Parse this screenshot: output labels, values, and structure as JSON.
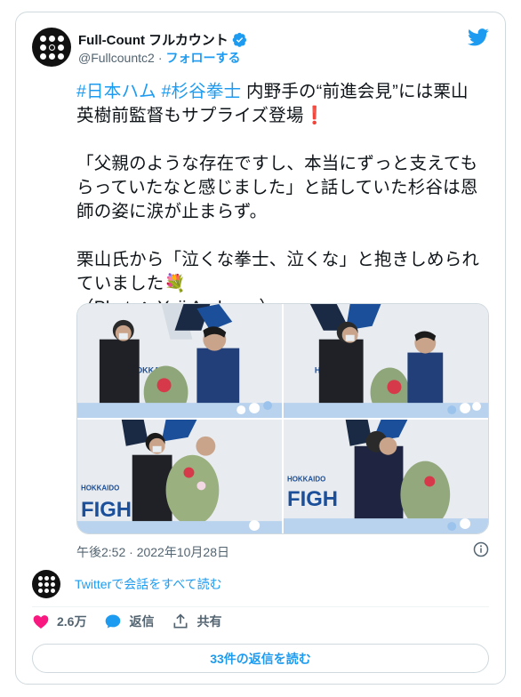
{
  "account": {
    "name": "Full-Count フルカウント",
    "handle": "@Fullcountc2",
    "separator": "·",
    "follow_label": "フォローする"
  },
  "tweet": {
    "line1_hashtag1": "#日本ハム",
    "line1_hashtag2": "#杉谷拳士",
    "line1_rest": " 内野手の“前進会見”には栗山",
    "line2": "英樹前監督もサプライズ登場",
    "line2_emoji": "❗",
    "para2_l1": "「父親のような存在ですし、本当にずっと支えても",
    "para2_l2": "らっていたなと感じました」と話していた杉谷は恩",
    "para2_l3": "師の姿に涙が止まらず。",
    "para3_l1": "栗山氏から「泣くな拳士、泣くな」と抱きしめられ",
    "para3_l2": "ていました",
    "para3_emoji": "💐",
    "para3_l3": "（Photo：Yuji Arakawa）"
  },
  "timestamp": "午後2:52 · 2022年10月28日",
  "thread": {
    "read_all": "Twitterで会話をすべて読む"
  },
  "actions": {
    "likes": "2.6万",
    "reply_label": "返信",
    "share_label": "共有"
  },
  "replies_button": "33件の返信を読む",
  "photo_text": {
    "hokkaido": "HOKKAIDO",
    "fighters": "FIGH"
  },
  "colors": {
    "accent": "#1d9bf0",
    "like": "#f91880",
    "muted": "#536471"
  }
}
